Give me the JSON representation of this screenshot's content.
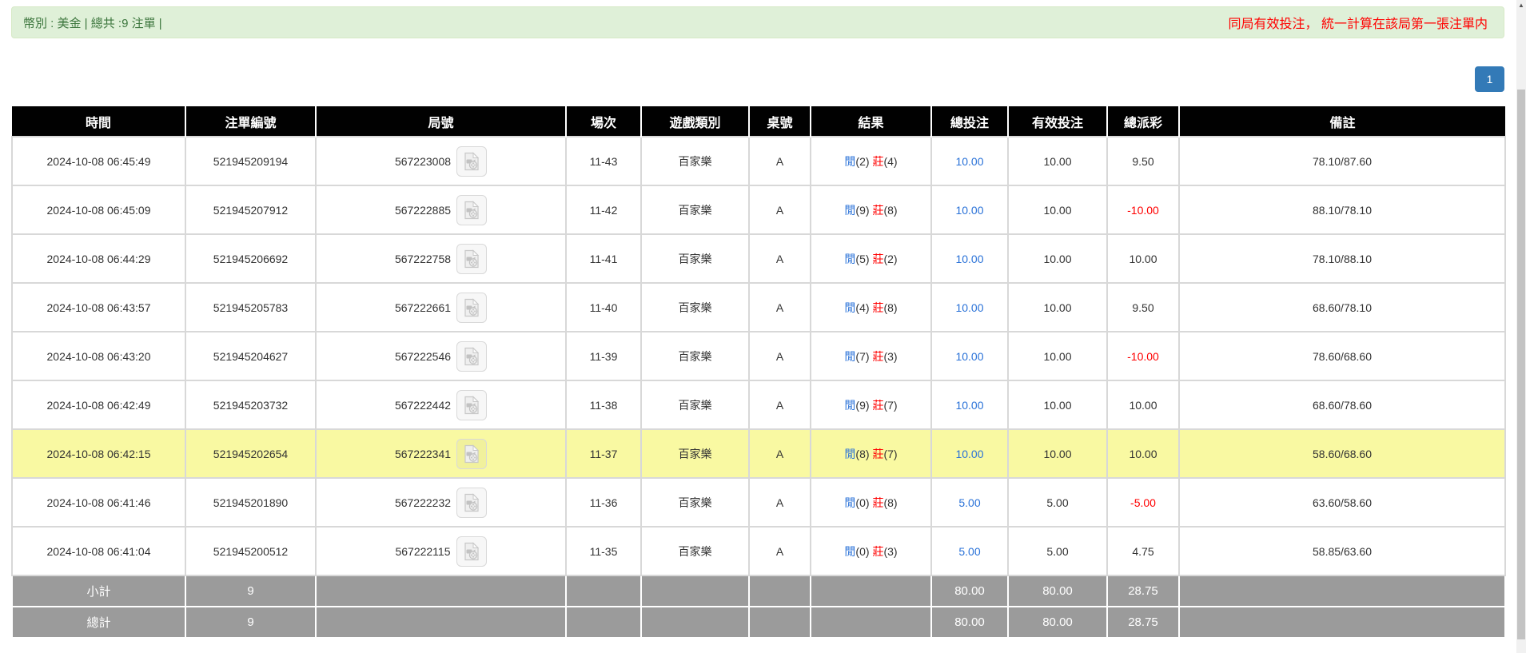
{
  "top_bar": {
    "summary_text": "幣別 : 美金 | 總共 :9 注單 |",
    "notice_text": "同局有效投注， 統一計算在該局第一張注單内"
  },
  "pagination": {
    "current_page": "1"
  },
  "colors": {
    "alert_bg": "#dff0d8",
    "alert_text": "#3c763d",
    "notice_red": "#ff0000",
    "header_bg": "#010101",
    "link_blue": "#2a72d8",
    "negative_red": "#ff0000",
    "highlight_yellow": "#f9f9a2",
    "summary_gray": "#9b9b9b",
    "page_btn_blue": "#337ab7"
  },
  "icons": {
    "round_cell_icon": "video-replay-icon",
    "scrollbar_arrow": "up-arrow"
  },
  "table": {
    "columns": [
      "時間",
      "注單編號",
      "局號",
      "場次",
      "遊戲類別",
      "桌號",
      "結果",
      "總投注",
      "有效投注",
      "總派彩",
      "備註"
    ],
    "rows": [
      {
        "time": "2024-10-08 06:45:49",
        "bet_id": "521945209194",
        "round_id": "567223008",
        "session": "11-43",
        "game_type": "百家樂",
        "table_code": "A",
        "p_label": "閒",
        "p_score": "(2)",
        "b_label": "莊",
        "b_score": "(4)",
        "total_bet": "10.00",
        "valid_bet": "10.00",
        "payout": "9.50",
        "remark": "78.10/87.60",
        "highlighted": false
      },
      {
        "time": "2024-10-08 06:45:09",
        "bet_id": "521945207912",
        "round_id": "567222885",
        "session": "11-42",
        "game_type": "百家樂",
        "table_code": "A",
        "p_label": "閒",
        "p_score": "(9)",
        "b_label": "莊",
        "b_score": "(8)",
        "total_bet": "10.00",
        "valid_bet": "10.00",
        "payout": "-10.00",
        "remark": "88.10/78.10",
        "highlighted": false
      },
      {
        "time": "2024-10-08 06:44:29",
        "bet_id": "521945206692",
        "round_id": "567222758",
        "session": "11-41",
        "game_type": "百家樂",
        "table_code": "A",
        "p_label": "閒",
        "p_score": "(5)",
        "b_label": "莊",
        "b_score": "(2)",
        "total_bet": "10.00",
        "valid_bet": "10.00",
        "payout": "10.00",
        "remark": "78.10/88.10",
        "highlighted": false
      },
      {
        "time": "2024-10-08 06:43:57",
        "bet_id": "521945205783",
        "round_id": "567222661",
        "session": "11-40",
        "game_type": "百家樂",
        "table_code": "A",
        "p_label": "閒",
        "p_score": "(4)",
        "b_label": "莊",
        "b_score": "(8)",
        "total_bet": "10.00",
        "valid_bet": "10.00",
        "payout": "9.50",
        "remark": "68.60/78.10",
        "highlighted": false
      },
      {
        "time": "2024-10-08 06:43:20",
        "bet_id": "521945204627",
        "round_id": "567222546",
        "session": "11-39",
        "game_type": "百家樂",
        "table_code": "A",
        "p_label": "閒",
        "p_score": "(7)",
        "b_label": "莊",
        "b_score": "(3)",
        "total_bet": "10.00",
        "valid_bet": "10.00",
        "payout": "-10.00",
        "remark": "78.60/68.60",
        "highlighted": false
      },
      {
        "time": "2024-10-08 06:42:49",
        "bet_id": "521945203732",
        "round_id": "567222442",
        "session": "11-38",
        "game_type": "百家樂",
        "table_code": "A",
        "p_label": "閒",
        "p_score": "(9)",
        "b_label": "莊",
        "b_score": "(7)",
        "total_bet": "10.00",
        "valid_bet": "10.00",
        "payout": "10.00",
        "remark": "68.60/78.60",
        "highlighted": false
      },
      {
        "time": "2024-10-08 06:42:15",
        "bet_id": "521945202654",
        "round_id": "567222341",
        "session": "11-37",
        "game_type": "百家樂",
        "table_code": "A",
        "p_label": "閒",
        "p_score": "(8)",
        "b_label": "莊",
        "b_score": "(7)",
        "total_bet": "10.00",
        "valid_bet": "10.00",
        "payout": "10.00",
        "remark": "58.60/68.60",
        "highlighted": true
      },
      {
        "time": "2024-10-08 06:41:46",
        "bet_id": "521945201890",
        "round_id": "567222232",
        "session": "11-36",
        "game_type": "百家樂",
        "table_code": "A",
        "p_label": "閒",
        "p_score": "(0)",
        "b_label": "莊",
        "b_score": "(8)",
        "total_bet": "5.00",
        "valid_bet": "5.00",
        "payout": "-5.00",
        "remark": "63.60/58.60",
        "highlighted": false
      },
      {
        "time": "2024-10-08 06:41:04",
        "bet_id": "521945200512",
        "round_id": "567222115",
        "session": "11-35",
        "game_type": "百家樂",
        "table_code": "A",
        "p_label": "閒",
        "p_score": "(0)",
        "b_label": "莊",
        "b_score": "(3)",
        "total_bet": "5.00",
        "valid_bet": "5.00",
        "payout": "4.75",
        "remark": "58.85/63.60",
        "highlighted": false
      }
    ],
    "subtotal": {
      "label": "小計",
      "count": "9",
      "total_bet": "80.00",
      "valid_bet": "80.00",
      "payout": "28.75",
      "remark": ""
    },
    "grand_total": {
      "label": "總計",
      "count": "9",
      "total_bet": "80.00",
      "valid_bet": "80.00",
      "payout": "28.75",
      "remark": ""
    }
  }
}
